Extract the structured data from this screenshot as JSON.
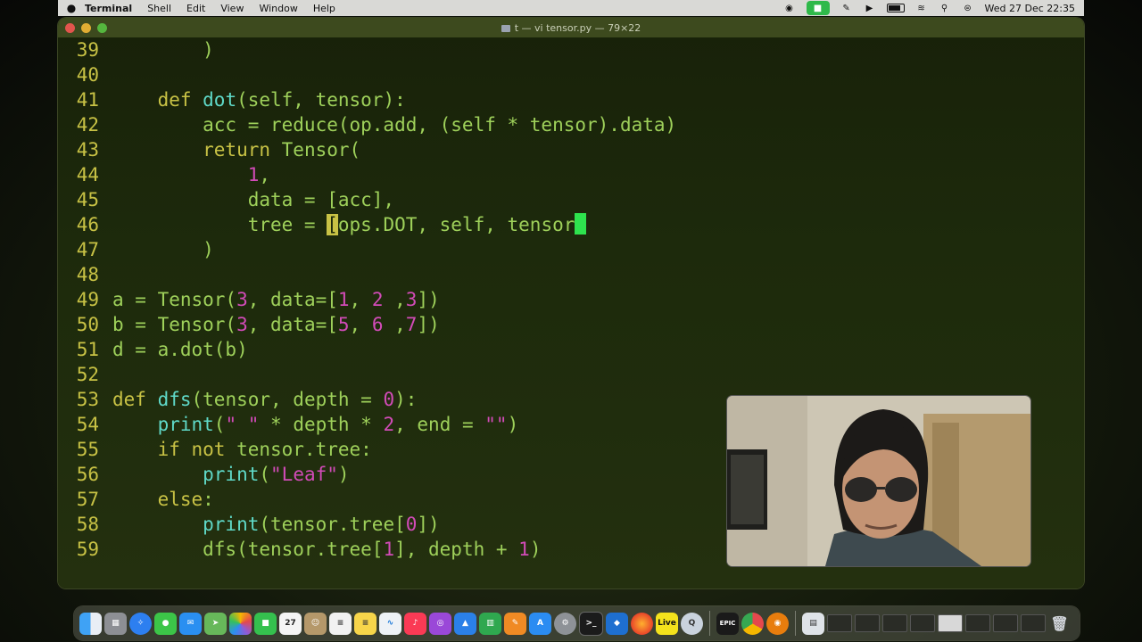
{
  "menubar": {
    "app_name": "Terminal",
    "menus": [
      "Shell",
      "Edit",
      "View",
      "Window",
      "Help"
    ],
    "clock": "Wed 27 Dec  22:35"
  },
  "window": {
    "title": "t — vi tensor.py — 79×22"
  },
  "code": {
    "line_numbers": [
      "39",
      "40",
      "41",
      "42",
      "43",
      "44",
      "45",
      "46",
      "47",
      "48",
      "49",
      "50",
      "51",
      "52",
      "53",
      "54",
      "55",
      "56",
      "57",
      "58",
      "59"
    ]
  },
  "dock": {
    "icons": [
      "finder-icon",
      "launchpad-icon",
      "safari-icon",
      "messages-icon",
      "mail-icon",
      "maps-icon",
      "photos-icon",
      "facetime-icon",
      "calendar-icon",
      "contacts-icon",
      "reminders-icon",
      "notes-icon",
      "freeform-icon",
      "music-icon",
      "podcasts-icon",
      "keynote-icon",
      "numbers-icon",
      "pages-icon",
      "app-store-icon",
      "system-settings-icon",
      "terminal-icon",
      "vscode-icon",
      "firefox-icon",
      "live-icon",
      "quicktime-icon",
      "epic-games-icon",
      "chrome-icon",
      "blender-icon",
      "preview-icon",
      "trash-icon"
    ],
    "calendar_day": "27",
    "live_label": "Live",
    "epic_label": "EPIC"
  },
  "colors": {
    "line_number": "#c8c245",
    "keyword": "#c8c245",
    "function": "#5fd9c8",
    "number": "#d24bb8",
    "default": "#9ed05a",
    "cursor": "#2ee34e"
  }
}
